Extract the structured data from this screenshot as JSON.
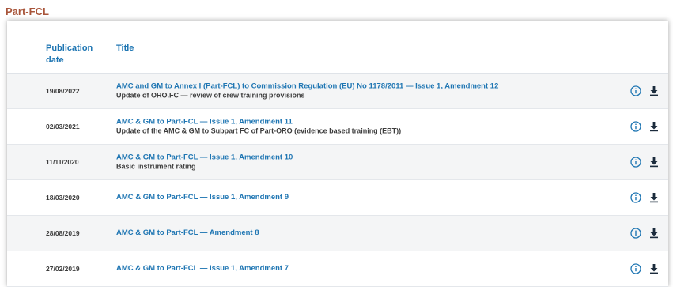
{
  "section": {
    "title": "Part-FCL"
  },
  "table": {
    "headers": {
      "date": "Publication date",
      "title": "Title"
    },
    "rows": [
      {
        "date": "19/08/2022",
        "title": "AMC and GM to Annex I (Part-FCL) to Commission Regulation (EU) No 1178/2011 — Issue 1, Amendment 12",
        "subtitle": "Update of ORO.FC — review of crew training provisions"
      },
      {
        "date": "02/03/2021",
        "title": "AMC & GM to Part-FCL — Issue 1, Amendment 11",
        "subtitle": "Update of the AMC & GM to Subpart FC of Part-ORO (evidence  based training (EBT))"
      },
      {
        "date": "11/11/2020",
        "title": "AMC & GM to Part-FCL — Issue 1, Amendment 10",
        "subtitle": "Basic instrument rating"
      },
      {
        "date": "18/03/2020",
        "title": "AMC & GM to Part-FCL — Issue 1, Amendment 9",
        "subtitle": ""
      },
      {
        "date": "28/08/2019",
        "title": "AMC & GM to Part-FCL — Amendment 8",
        "subtitle": ""
      },
      {
        "date": "27/02/2019",
        "title": "AMC & GM to Part-FCL — Issue 1, Amendment 7",
        "subtitle": ""
      }
    ]
  },
  "icons": {
    "info": "info-circle-icon",
    "download": "download-icon"
  },
  "colors": {
    "accent": "#1f76b3",
    "section_title": "#a8553a",
    "row_alt": "#f4f5f6"
  }
}
